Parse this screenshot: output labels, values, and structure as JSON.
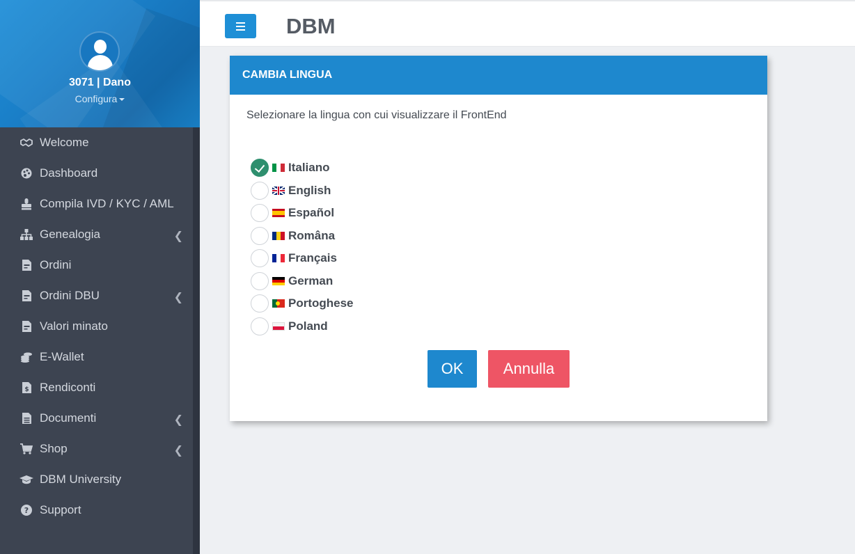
{
  "app": {
    "title": "DBM"
  },
  "user": {
    "name": "3071 | Dano",
    "menu_label": "Configura"
  },
  "sidebar": {
    "items": [
      {
        "label": "Welcome",
        "icon": "handshake-icon",
        "has_submenu": false
      },
      {
        "label": "Dashboard",
        "icon": "palette-icon",
        "has_submenu": false
      },
      {
        "label": "Compila IVD / KYC / AML",
        "icon": "stamp-icon",
        "has_submenu": false
      },
      {
        "label": "Genealogia",
        "icon": "sitemap-icon",
        "has_submenu": true
      },
      {
        "label": "Ordini",
        "icon": "file-invoice-icon",
        "has_submenu": false
      },
      {
        "label": "Ordini DBU",
        "icon": "file-invoice-icon",
        "has_submenu": true
      },
      {
        "label": "Valori minato",
        "icon": "file-invoice-icon",
        "has_submenu": false
      },
      {
        "label": "E-Wallet",
        "icon": "coins-icon",
        "has_submenu": false
      },
      {
        "label": "Rendiconti",
        "icon": "file-dollar-icon",
        "has_submenu": false
      },
      {
        "label": "Documenti",
        "icon": "file-text-icon",
        "has_submenu": true
      },
      {
        "label": "Shop",
        "icon": "shopping-cart-icon",
        "has_submenu": true
      },
      {
        "label": "DBM University",
        "icon": "graduation-cap-icon",
        "has_submenu": false
      },
      {
        "label": "Support",
        "icon": "question-circle-icon",
        "has_submenu": false
      }
    ]
  },
  "modal": {
    "title": "CAMBIA LINGUA",
    "description": "Selezionare la lingua con cui visualizzare il FrontEnd",
    "languages": [
      {
        "label": "Italiano",
        "flag": "flag-italy-icon",
        "selected": true
      },
      {
        "label": "English",
        "flag": "flag-uk-icon",
        "selected": false
      },
      {
        "label": "Español",
        "flag": "flag-spain-icon",
        "selected": false
      },
      {
        "label": "Româna",
        "flag": "flag-romania-icon",
        "selected": false
      },
      {
        "label": "Français",
        "flag": "flag-france-icon",
        "selected": false
      },
      {
        "label": "German",
        "flag": "flag-germany-icon",
        "selected": false
      },
      {
        "label": "Portoghese",
        "flag": "flag-portugal-icon",
        "selected": false
      },
      {
        "label": "Poland",
        "flag": "flag-poland-icon",
        "selected": false
      }
    ],
    "ok_label": "OK",
    "cancel_label": "Annulla"
  },
  "colors": {
    "primary": "#1e88ce",
    "danger": "#ee5565",
    "sidebar_bg": "#3d4451",
    "selected_radio": "#2e8f6e"
  }
}
